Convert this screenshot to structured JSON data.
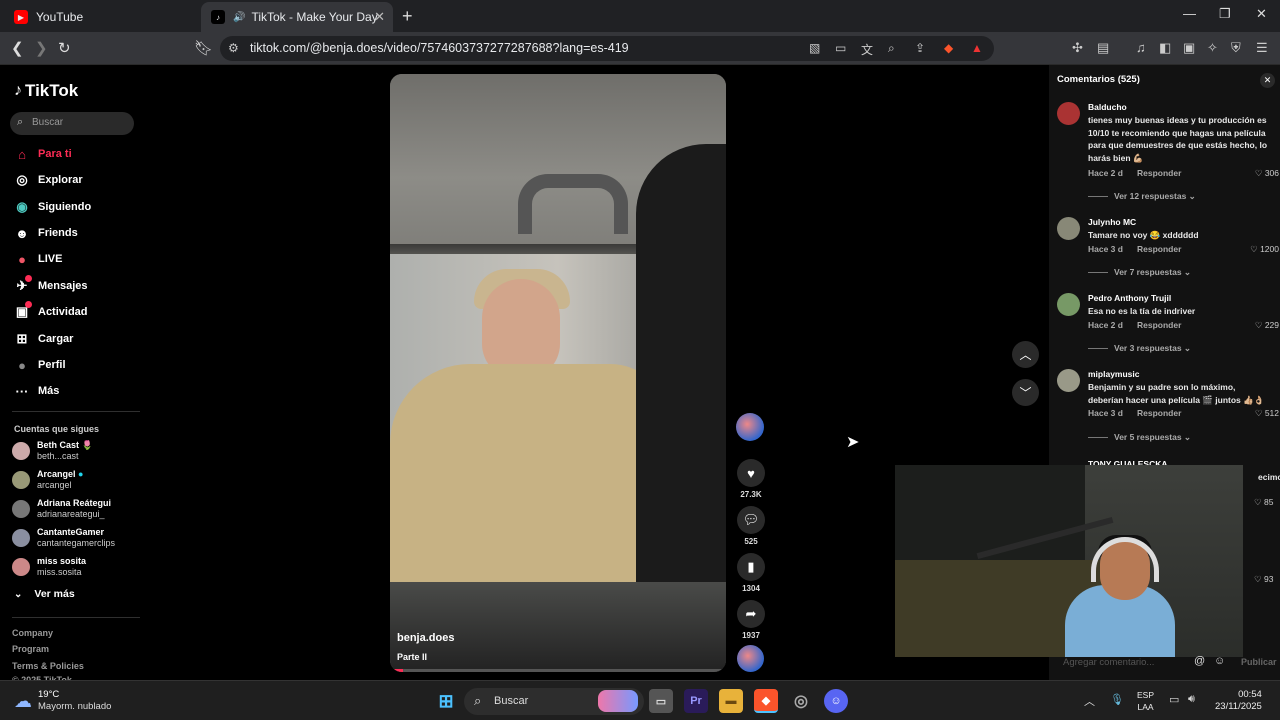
{
  "browser": {
    "tabs": [
      {
        "title": "YouTube"
      },
      {
        "title": "TikTok - Make Your Day"
      }
    ],
    "url": "tiktok.com/@benja.does/video/7574603737277287688?lang=es-419"
  },
  "sidebar": {
    "logo": "TikTok",
    "search_placeholder": "Buscar",
    "nav": [
      {
        "label": "Para ti",
        "icon": "home-icon",
        "glyph": "⌂"
      },
      {
        "label": "Explorar",
        "icon": "compass-icon",
        "glyph": "◎"
      },
      {
        "label": "Siguiendo",
        "icon": "following-icon",
        "glyph": "◉"
      },
      {
        "label": "Friends",
        "icon": "friends-icon",
        "glyph": "☻"
      },
      {
        "label": "LIVE",
        "icon": "live-icon",
        "glyph": "●"
      },
      {
        "label": "Mensajes",
        "icon": "messages-icon",
        "glyph": "✈"
      },
      {
        "label": "Actividad",
        "icon": "activity-icon",
        "glyph": "▣"
      },
      {
        "label": "Cargar",
        "icon": "upload-icon",
        "glyph": "⊞"
      },
      {
        "label": "Perfil",
        "icon": "profile-icon",
        "glyph": "●"
      },
      {
        "label": "Más",
        "icon": "more-icon",
        "glyph": "···"
      }
    ],
    "following_title": "Cuentas que sigues",
    "following": [
      {
        "name": "Beth Cast 🌷",
        "handle": "beth...cast"
      },
      {
        "name": "Arcangel",
        "handle": "arcangel"
      },
      {
        "name": "Adriana Reátegui",
        "handle": "adrianareategui_"
      },
      {
        "name": "CantanteGamer",
        "handle": "cantantegamerclips"
      },
      {
        "name": "miss sosita",
        "handle": "miss.sosita"
      }
    ],
    "see_more": "Ver más",
    "footer": [
      "Company",
      "Program",
      "Terms & Policies",
      "© 2025 TikTok"
    ]
  },
  "video": {
    "author": "benja.does",
    "caption": "Parte II",
    "progress": 0.04
  },
  "actions": {
    "likes": "27.3K",
    "comments": "525",
    "saves": "1304",
    "shares": "1937"
  },
  "comments_panel": {
    "title": "Comentarios (525)",
    "items": [
      {
        "user": "Balducho",
        "text": "tienes muy buenas ideas y tu producción es 10/10 te recomiendo que hagas una película para que demuestres de que estás hecho, lo harás bien 💪🏼",
        "time": "Hace 2 d",
        "reply": "Responder",
        "likes": "306",
        "replies": "Ver 12 respuestas ⌄"
      },
      {
        "user": "Julynho MC",
        "text": "Tamare no voy 😂 xdddddd",
        "time": "Hace 3 d",
        "reply": "Responder",
        "likes": "1200",
        "replies": "Ver 7 respuestas ⌄"
      },
      {
        "user": "Pedro Anthony Trujil",
        "text": "Esa no es la tía de indriver",
        "time": "Hace 2 d",
        "reply": "Responder",
        "likes": "229",
        "replies": "Ver 3 respuestas ⌄"
      },
      {
        "user": "miplaymusic",
        "text": "Benjamin y su padre son lo máximo, deberían hacer una película 🎬 juntos 👍🏼👌🏼",
        "time": "Hace 3 d",
        "reply": "Responder",
        "likes": "512",
        "replies": "Ver 5 respuestas ⌄"
      }
    ],
    "partial_user": "TONY GUALESCKA",
    "partial_text": "ecimos",
    "partial_likes_1": "85",
    "partial_likes_2": "93",
    "input_placeholder": "Agregar comentario...",
    "publish": "Publicar"
  },
  "taskbar": {
    "weather_temp": "19°C",
    "weather_desc": "Mayorm. nublado",
    "search": "Buscar",
    "lang_1": "ESP",
    "lang_2": "LAA",
    "time": "00:54",
    "date": "23/11/2025"
  }
}
